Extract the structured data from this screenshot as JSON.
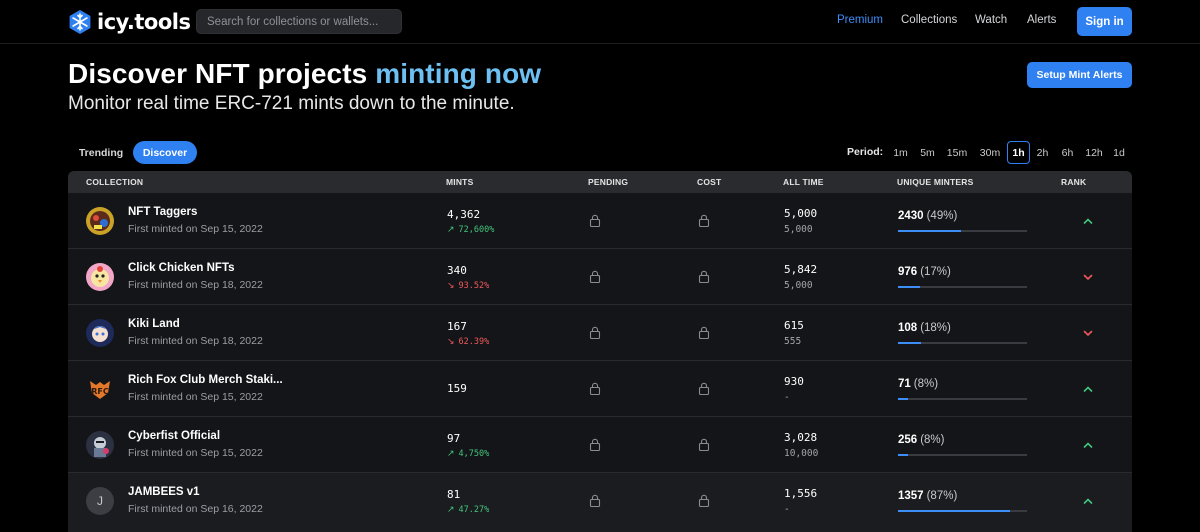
{
  "app": {
    "logo_text": "icy.tools"
  },
  "search": {
    "placeholder": "Search for collections or wallets..."
  },
  "nav": {
    "premium": "Premium",
    "collections": "Collections",
    "watch": "Watch",
    "alerts": "Alerts",
    "signin": "Sign in"
  },
  "hero": {
    "title_main": "Discover NFT projects",
    "title_accent": "minting now",
    "subtitle": "Monitor real time ERC-721 mints down to the minute.",
    "cta": "Setup Mint Alerts"
  },
  "tabs": [
    {
      "label": "Trending",
      "active": false
    },
    {
      "label": "Discover",
      "active": true
    }
  ],
  "period": {
    "label": "Period:",
    "options": [
      "1m",
      "5m",
      "15m",
      "30m",
      "1h",
      "2h",
      "6h",
      "12h",
      "1d"
    ],
    "selected": "1h"
  },
  "table": {
    "headers": {
      "collection": "COLLECTION",
      "mints": "MINTS",
      "pending": "PENDING",
      "cost": "COST",
      "all_time": "ALL TIME",
      "unique_minters": "UNIQUE MINTERS",
      "rank": "RANK"
    },
    "rows": [
      {
        "name": "NFT Taggers",
        "first_minted": "First minted on Sep 15, 2022",
        "mints": "4,362",
        "change": "72,600%",
        "direction": "up",
        "all_time": "5,000",
        "all_time_sub": "5,000",
        "unique": "2430",
        "unique_pct": "(49%)",
        "unique_frac": 0.49,
        "rank": "up",
        "avatar": "taggers-avatar"
      },
      {
        "name": "Click Chicken NFTs",
        "first_minted": "First minted on Sep 18, 2022",
        "mints": "340",
        "change": "93.52%",
        "direction": "down",
        "all_time": "5,842",
        "all_time_sub": "5,000",
        "unique": "976",
        "unique_pct": "(17%)",
        "unique_frac": 0.17,
        "rank": "down",
        "avatar": "chicken-avatar"
      },
      {
        "name": "Kiki Land",
        "first_minted": "First minted on Sep 18, 2022",
        "mints": "167",
        "change": "62.39%",
        "direction": "down",
        "all_time": "615",
        "all_time_sub": "555",
        "unique": "108",
        "unique_pct": "(18%)",
        "unique_frac": 0.18,
        "rank": "down",
        "avatar": "kiki-avatar"
      },
      {
        "name": "Rich Fox Club Merch Staki...",
        "first_minted": "First minted on Sep 15, 2022",
        "mints": "159",
        "change": "",
        "direction": "none",
        "all_time": "930",
        "all_time_sub": "-",
        "unique": "71",
        "unique_pct": "(8%)",
        "unique_frac": 0.08,
        "rank": "up",
        "avatar": "fox-avatar"
      },
      {
        "name": "Cyberfist Official",
        "first_minted": "First minted on Sep 15, 2022",
        "mints": "97",
        "change": "4,750%",
        "direction": "up",
        "all_time": "3,028",
        "all_time_sub": "10,000",
        "unique": "256",
        "unique_pct": "(8%)",
        "unique_frac": 0.08,
        "rank": "up",
        "avatar": "cyberfist-avatar"
      },
      {
        "name": "JAMBEES v1",
        "first_minted": "First minted on Sep 16, 2022",
        "mints": "81",
        "change": "47.27%",
        "direction": "up",
        "all_time": "1,556",
        "all_time_sub": "-",
        "unique": "1357",
        "unique_pct": "(87%)",
        "unique_frac": 0.87,
        "rank": "up",
        "avatar_letter": "J"
      }
    ]
  },
  "colors": {
    "accent_blue": "#2f80f1",
    "accent_cyan": "#6ec0f3",
    "positive": "#43c47b",
    "negative": "#f0585c"
  }
}
